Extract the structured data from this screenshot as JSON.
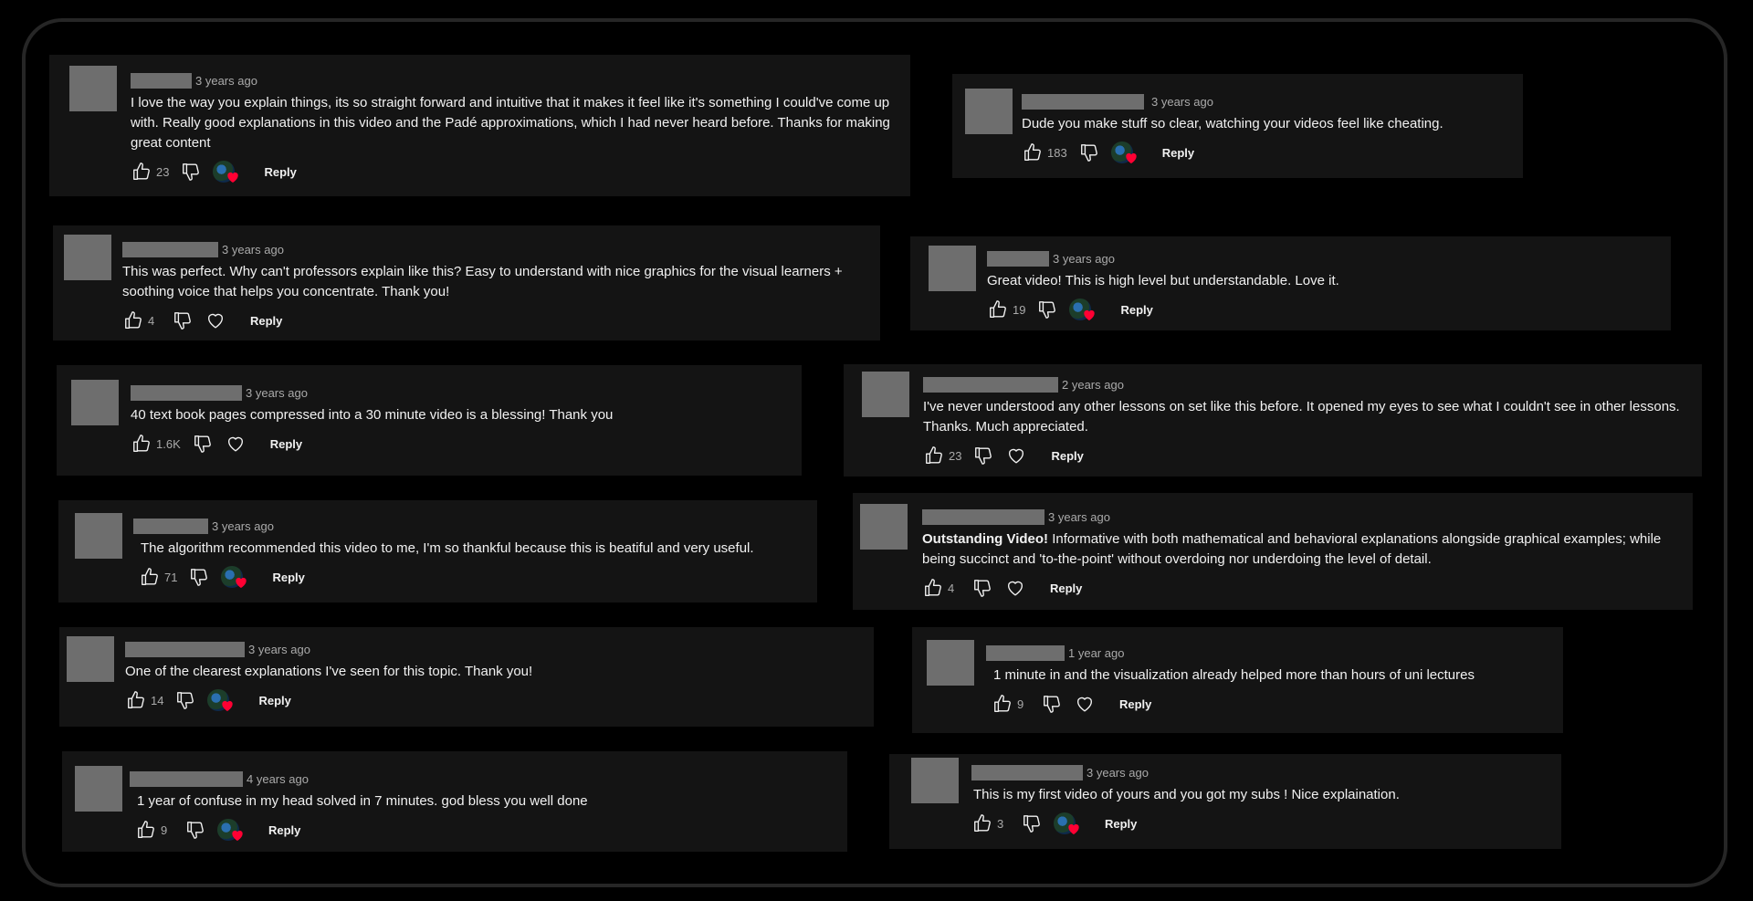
{
  "comments": [
    {
      "time": "3 years ago",
      "text": "I love the way you explain things, its so straight forward and intuitive that it makes it feel like it's something I could've come up with. Really good explanations in this video and the Padé approximations, which I had never heard before. Thanks for making great content",
      "likes": "23",
      "reply": "Reply"
    },
    {
      "time": "3 years ago",
      "text": "Dude you make stuff so clear, watching your videos feel like cheating.",
      "likes": "183",
      "reply": "Reply"
    },
    {
      "time": "3 years ago",
      "text": "This was perfect. Why can't professors explain like this? Easy to understand with nice graphics for the visual learners + soothing voice that helps you concentrate. Thank you!",
      "likes": "4",
      "reply": "Reply"
    },
    {
      "time": "3 years ago",
      "text": "Great video! This is high level but understandable. Love it.",
      "likes": "19",
      "reply": "Reply"
    },
    {
      "time": "3 years ago",
      "text": "40 text book pages compressed into a 30 minute video is a blessing! Thank you",
      "likes": "1.6K",
      "reply": "Reply"
    },
    {
      "time": "2 years ago",
      "text": "I've never understood any other lessons on set like this before. It opened my eyes to see what I couldn't see in other lessons. Thanks. Much appreciated.",
      "likes": "23",
      "reply": "Reply"
    },
    {
      "time": "3 years ago",
      "text": "The algorithm recommended this video to me, I'm so thankful because this is beatiful and very useful.",
      "likes": "71",
      "reply": "Reply"
    },
    {
      "time": "3 years ago",
      "text_bold": "Outstanding Video!",
      "text": " Informative with both mathematical and behavioral explanations alongside graphical examples; while being succinct and 'to-the-point' without overdoing nor underdoing the level of detail.",
      "likes": "4",
      "reply": "Reply"
    },
    {
      "time": "3 years ago",
      "text": "One of the clearest explanations I've seen for this topic. Thank you!",
      "likes": "14",
      "reply": "Reply"
    },
    {
      "time": "1 year ago",
      "text": "1 minute in and the visualization already helped more than hours of uni lectures",
      "likes": "9",
      "reply": "Reply"
    },
    {
      "time": "4 years ago",
      "text": "1 year of confuse in my head solved in 7 minutes. god bless you well done",
      "likes": "9",
      "reply": "Reply"
    },
    {
      "time": "3 years ago",
      "text": "This is my first video of yours and you got my subs ! Nice explaination.",
      "likes": "3",
      "reply": "Reply"
    }
  ]
}
